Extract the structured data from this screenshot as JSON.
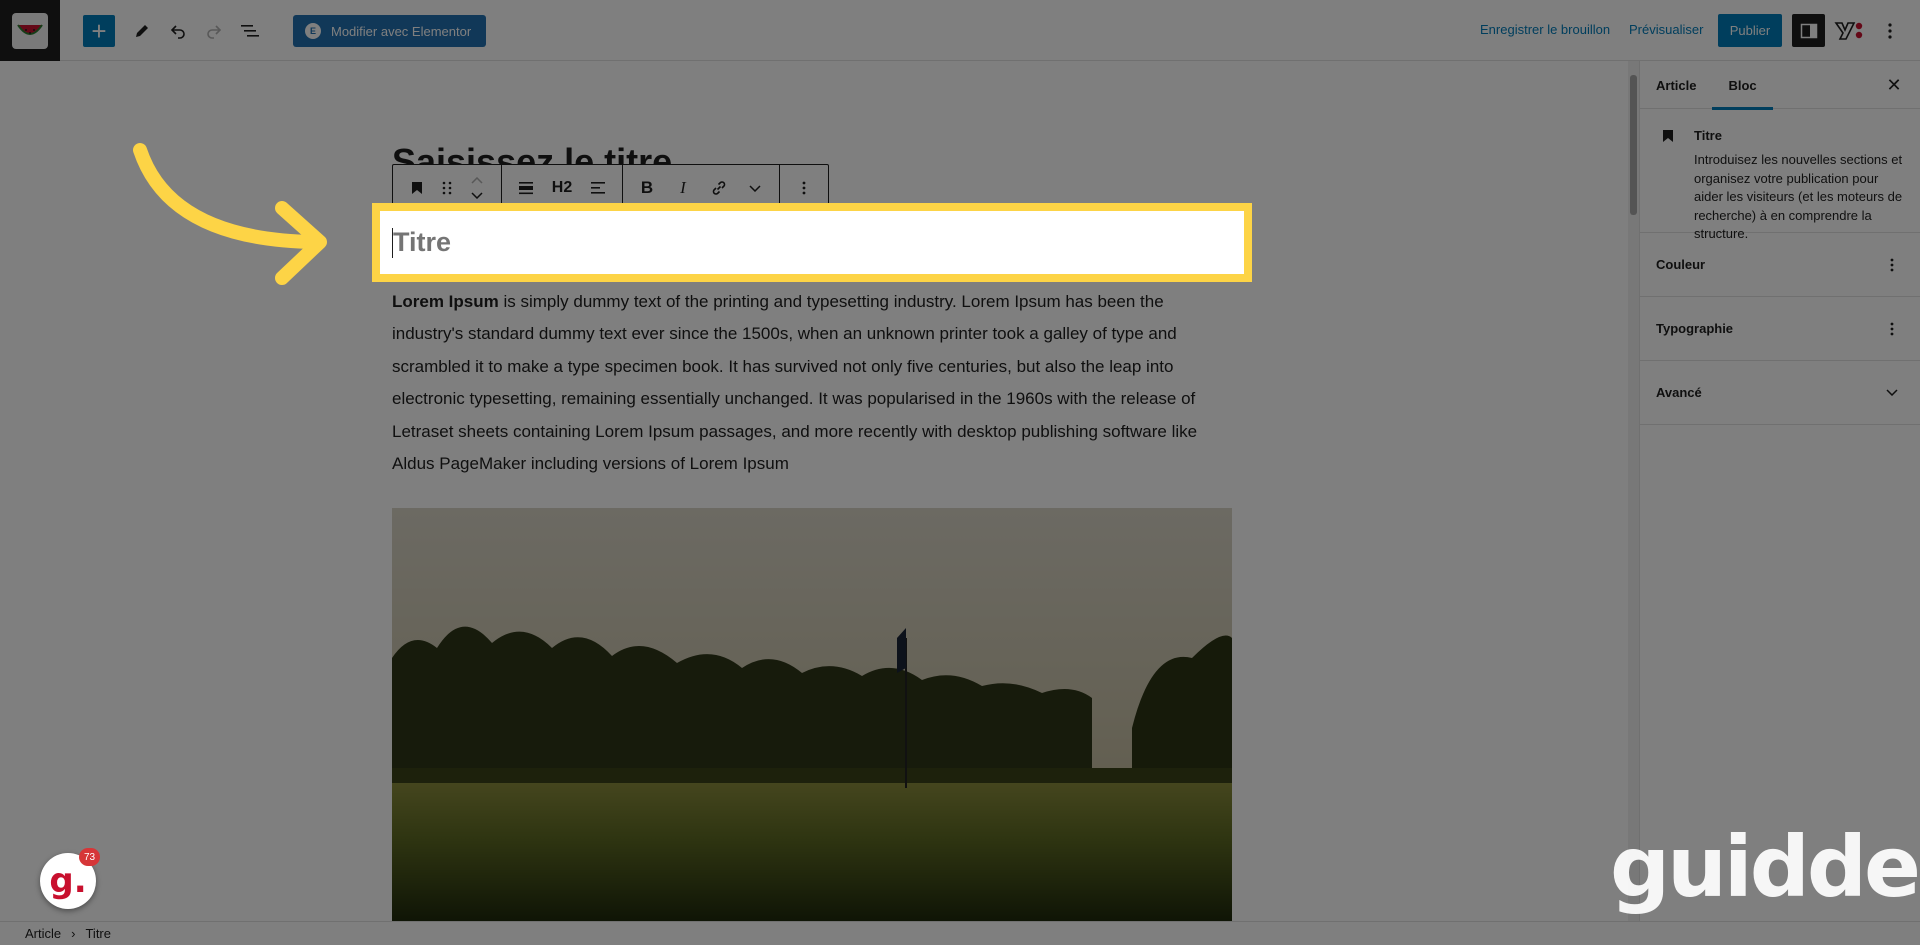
{
  "topbar": {
    "elementor_label": "Modifier avec Elementor",
    "save_draft_label": "Enregistrer le brouillon",
    "preview_label": "Prévisualiser",
    "publish_label": "Publier"
  },
  "editor": {
    "post_title_placeholder": "Saisissez le titre",
    "toolbar": {
      "heading_level": "H2"
    },
    "heading_placeholder": "Titre",
    "paragraph_bold": "Lorem Ipsum",
    "paragraph_text": " is simply dummy text of the printing and typesetting industry. Lorem Ipsum has been the industry's standard dummy text ever since the 1500s, when an unknown printer took a galley of type and scrambled it to make a type specimen book. It has survived not only five centuries, but also the leap into electronic typesetting, remaining essentially unchanged. It was popularised in the 1960s with the release of Letraset sheets containing Lorem Ipsum passages, and more recently with desktop publishing software like Aldus PageMaker including versions of Lorem Ipsum"
  },
  "sidebar": {
    "tabs": [
      "Article",
      "Bloc"
    ],
    "active_tab": "Bloc",
    "block_title": "Titre",
    "block_description": "Introduisez les nouvelles sections et organisez votre publication pour aider les visiteurs (et les moteurs de recherche) à en comprendre la structure.",
    "panels": [
      "Couleur",
      "Typographie",
      "Avancé"
    ]
  },
  "footer": {
    "breadcrumb": [
      "Article",
      "Titre"
    ]
  },
  "watermark": {
    "brand": "guidde.",
    "badge_letter": "g.",
    "badge_count": "73"
  },
  "colors": {
    "accent": "#007cba",
    "highlight": "#fdd446",
    "elementor": "#2271b1"
  },
  "icons": [
    "block-inserter-plus-icon",
    "pencil-icon",
    "undo-icon",
    "redo-icon",
    "list-view-icon",
    "settings-sidebar-icon",
    "yoast-icon",
    "more-vertical-icon",
    "bookmark-icon",
    "drag-handle-icon",
    "chevron-up-icon",
    "chevron-down-icon",
    "align-icon",
    "text-align-icon",
    "bold-icon",
    "italic-icon",
    "link-icon",
    "close-icon"
  ]
}
